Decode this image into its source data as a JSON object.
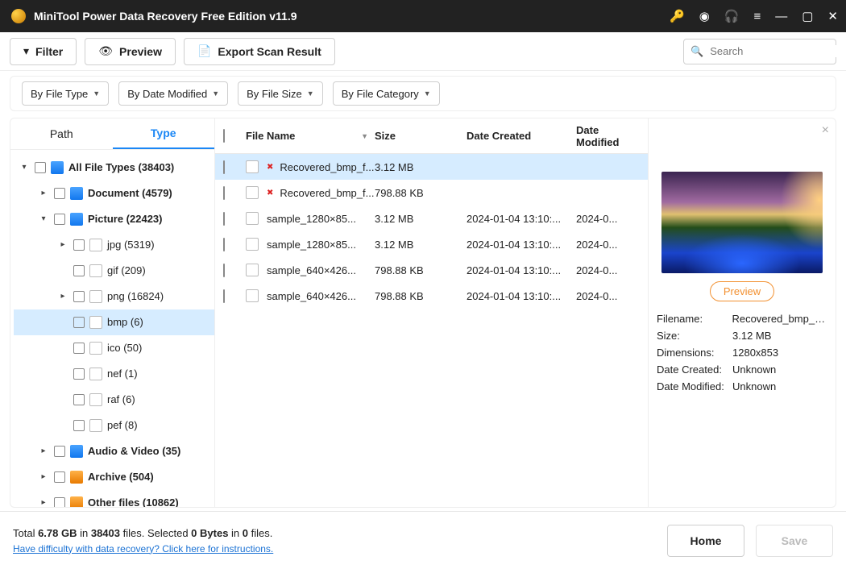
{
  "titlebar": {
    "title": "MiniTool Power Data Recovery Free Edition v11.9"
  },
  "toolbar": {
    "filter": "Filter",
    "preview": "Preview",
    "export": "Export Scan Result"
  },
  "search": {
    "placeholder": "Search"
  },
  "filters": {
    "byType": "By File Type",
    "byDate": "By Date Modified",
    "bySize": "By File Size",
    "byCat": "By File Category"
  },
  "sidebar": {
    "tabs": {
      "path": "Path",
      "type": "Type"
    },
    "nodes": {
      "all": "All File Types (38403)",
      "document": "Document (4579)",
      "picture": "Picture (22423)",
      "jpg": "jpg (5319)",
      "gif": "gif (209)",
      "png": "png (16824)",
      "bmp": "bmp (6)",
      "ico": "ico (50)",
      "nef": "nef (1)",
      "raf": "raf (6)",
      "pef": "pef (8)",
      "av": "Audio & Video (35)",
      "archive": "Archive (504)",
      "other": "Other files (10862)"
    }
  },
  "table": {
    "headers": {
      "name": "File Name",
      "size": "Size",
      "dc": "Date Created",
      "dm": "Date Modified"
    },
    "rows": [
      {
        "name": "Recovered_bmp_f...",
        "size": "3.12 MB",
        "dc": "",
        "dm": "",
        "deleted": true,
        "selected": true
      },
      {
        "name": "Recovered_bmp_f...",
        "size": "798.88 KB",
        "dc": "",
        "dm": "",
        "deleted": true
      },
      {
        "name": "sample_1280×85...",
        "size": "3.12 MB",
        "dc": "2024-01-04 13:10:...",
        "dm": "2024-0..."
      },
      {
        "name": "sample_1280×85...",
        "size": "3.12 MB",
        "dc": "2024-01-04 13:10:...",
        "dm": "2024-0..."
      },
      {
        "name": "sample_640×426...",
        "size": "798.88 KB",
        "dc": "2024-01-04 13:10:...",
        "dm": "2024-0..."
      },
      {
        "name": "sample_640×426...",
        "size": "798.88 KB",
        "dc": "2024-01-04 13:10:...",
        "dm": "2024-0..."
      }
    ]
  },
  "preview": {
    "button": "Preview",
    "meta": {
      "filename_k": "Filename:",
      "filename_v": "Recovered_bmp_file",
      "size_k": "Size:",
      "size_v": "3.12 MB",
      "dim_k": "Dimensions:",
      "dim_v": "1280x853",
      "dc_k": "Date Created:",
      "dc_v": "Unknown",
      "dm_k": "Date Modified:",
      "dm_v": "Unknown"
    }
  },
  "footer": {
    "totals_pre": "Total ",
    "totals_size": "6.78 GB",
    "totals_mid1": " in ",
    "totals_count": "38403",
    "totals_mid2": " files.",
    "selected_pre": "  Selected ",
    "selected_bytes": "0 Bytes",
    "selected_mid": " in ",
    "selected_n": "0",
    "selected_post": " files.",
    "help": "Have difficulty with data recovery? Click here for instructions.",
    "home": "Home",
    "save": "Save"
  }
}
